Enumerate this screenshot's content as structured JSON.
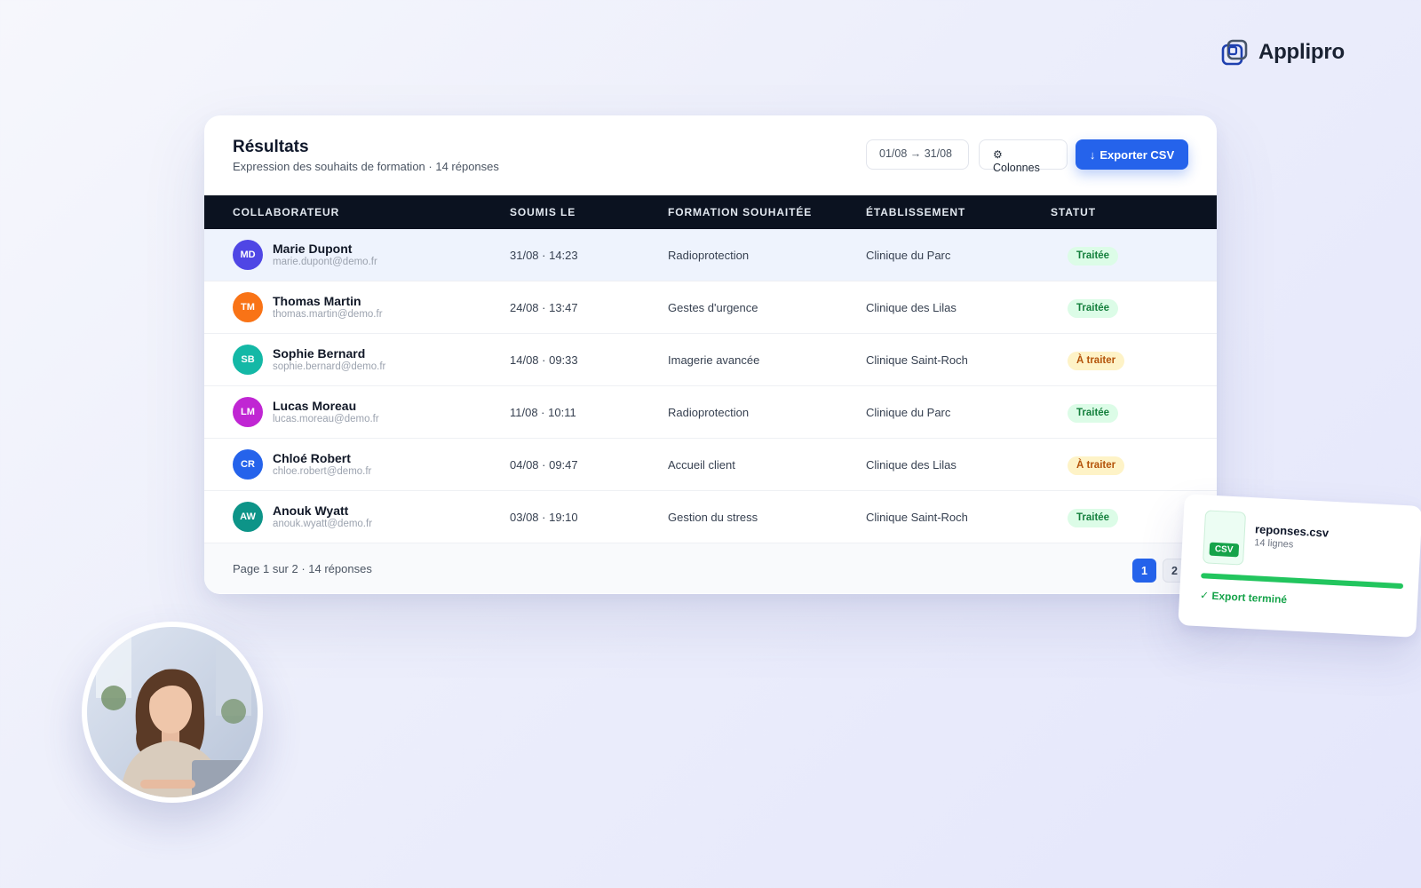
{
  "brand": {
    "name": "Applipro"
  },
  "card": {
    "title": "Résultats",
    "subtitle": "Expression des souhaits de formation · 14 réponses",
    "date_range": "01/08 → 31/08",
    "columns_label": "Colonnes",
    "columns_icon": "gear-icon",
    "export_label": "Exporter CSV",
    "export_icon": "download-arrow-icon"
  },
  "table": {
    "headers": [
      "COLLABORATEUR",
      "SOUMIS LE",
      "FORMATION SOUHAITÉE",
      "ÉTABLISSEMENT",
      "STATUT"
    ],
    "rows": [
      {
        "initials": "MD",
        "name": "Marie Dupont",
        "email": "marie.dupont@demo.fr",
        "submitted": "31/08 · 14:23",
        "training": "Radioprotection",
        "site": "Clinique du Parc",
        "status": "Traitée"
      },
      {
        "initials": "TM",
        "name": "Thomas Martin",
        "email": "thomas.martin@demo.fr",
        "submitted": "24/08 · 13:47",
        "training": "Gestes d'urgence",
        "site": "Clinique des Lilas",
        "status": "Traitée"
      },
      {
        "initials": "SB",
        "name": "Sophie Bernard",
        "email": "sophie.bernard@demo.fr",
        "submitted": "14/08 · 09:33",
        "training": "Imagerie avancée",
        "site": "Clinique Saint-Roch",
        "status": "À traiter"
      },
      {
        "initials": "LM",
        "name": "Lucas Moreau",
        "email": "lucas.moreau@demo.fr",
        "submitted": "11/08 · 10:11",
        "training": "Radioprotection",
        "site": "Clinique du Parc",
        "status": "Traitée"
      },
      {
        "initials": "CR",
        "name": "Chloé Robert",
        "email": "chloe.robert@demo.fr",
        "submitted": "04/08 · 09:47",
        "training": "Accueil client",
        "site": "Clinique des Lilas",
        "status": "À traiter"
      },
      {
        "initials": "AW",
        "name": "Anouk Wyatt",
        "email": "anouk.wyatt@demo.fr",
        "submitted": "03/08 · 19:10",
        "training": "Gestion du stress",
        "site": "Clinique Saint-Roch",
        "status": "Traitée"
      }
    ],
    "avatar_colors": [
      "#4f46e5",
      "#f97316",
      "#14b8a6",
      "#c026d3",
      "#2563eb",
      "#0d9488"
    ],
    "status_colors": {
      "done_bg": "#dcfce7",
      "done_text": "#15803d",
      "todo_bg": "#fef3c7",
      "todo_text": "#b45309"
    }
  },
  "footer": {
    "page_info": "Page 1 sur 2 · 14 réponses",
    "pages": [
      "1",
      "2"
    ]
  },
  "export_toast": {
    "file_name": "reponses.csv",
    "file_lines": "14 lignes",
    "file_tag": "CSV",
    "progress": 1.0,
    "status": "✓ Export terminé"
  },
  "colors": {
    "accent": "#2563eb",
    "table_header_bg": "#0b1220",
    "success": "#16a34a"
  }
}
